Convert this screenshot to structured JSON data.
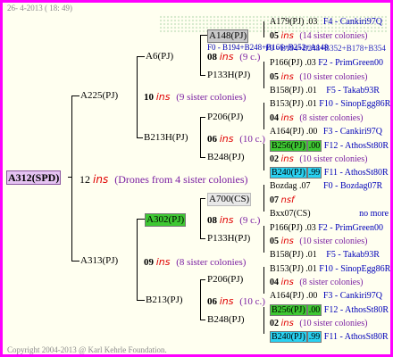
{
  "header": {
    "date": "26- 4-2013 ( 18: 49)"
  },
  "footer": {
    "copyright": "Copyright 2004-2013 @ Karl Kehrle Foundation."
  },
  "root": {
    "id": "A312(SPD)",
    "num": "12",
    "ins": "ins",
    "note": "(Drones from 4 sister colonies)"
  },
  "g1": {
    "top": {
      "id": "A225(PJ)",
      "num": "10",
      "ins": "ins",
      "note": "(9 sister colonies)"
    },
    "bottom": {
      "id": "A313(PJ)",
      "num": "09",
      "ins": "ins",
      "note": "(8 sister colonies)"
    }
  },
  "g2": {
    "a6": {
      "id": "A6(PJ)",
      "num": "08",
      "ins": "ins",
      "note": "(9 c.)"
    },
    "b213_top": {
      "id": "B213H(PJ)",
      "num": "06",
      "ins": "ins",
      "note": "(10 c.)"
    },
    "a302": {
      "id": "A302(PJ)",
      "num": "08",
      "ins": "ins",
      "note": "(9 c.)"
    },
    "b213_bottom": {
      "id": "B213(PJ)",
      "num": "06",
      "ins": "ins",
      "note": "(10 c.)"
    }
  },
  "g3": {
    "a148": {
      "id": "A148(PJ)"
    },
    "p133h_top": {
      "id": "P133H(PJ)"
    },
    "p206_top": {
      "id": "P206(PJ)"
    },
    "b248_top": {
      "id": "B248(PJ)"
    },
    "a700": {
      "id": "A700(CS)",
      "num": "07",
      "ins": "ins"
    },
    "p133h_bottom": {
      "id": "P133H(PJ)"
    },
    "p206_bottom": {
      "id": "P206(PJ)"
    },
    "b248_bottom": {
      "id": "B248(PJ)"
    }
  },
  "g4": {
    "r1": {
      "id": "A179(PJ)",
      "dot": ".03",
      "note": "F4 - Cankiri97Q"
    },
    "r2": {
      "num": "05",
      "ins": "ins",
      "note": "(14 sister colonies)"
    },
    "r3": {
      "text": "F0 - B194+B248+B166+B252+A148",
      "overlap": "F0 - B194+B248+B352+B178+B354"
    },
    "r4": {
      "id": "P166(PJ)",
      "dot": ".03",
      "note": "F2 - PrimGreen00"
    },
    "r5": {
      "num": "05",
      "ins": "ins",
      "note": "(10 sister colonies)"
    },
    "r6": {
      "id": "B158(PJ)",
      "dot": ".01",
      "note": "F5 - Takab93R"
    },
    "r7": {
      "id": "B153(PJ)",
      "dot": ".01",
      "note": "F10 - SinopEgg86R"
    },
    "r8": {
      "num": "04",
      "ins": "ins",
      "note": "(8 sister colonies)"
    },
    "r9": {
      "id": "A164(PJ)",
      "dot": ".00",
      "note": "F3 - Cankiri97Q"
    },
    "r10": {
      "id": "B256(PJ)",
      "dot": ".00",
      "note": "F12 - AthosSt80R"
    },
    "r11": {
      "num": "02",
      "ins": "ins",
      "note": "(10 sister colonies)"
    },
    "r12": {
      "id": "B240(PJ)",
      "dot": ".99",
      "note": "F11 - AthosSt80R"
    },
    "r13": {
      "id": "Bozdag",
      "dot": ".07",
      "note": "F0 - Bozdag07R"
    },
    "r14": {
      "num": "07",
      "ins": "nsf"
    },
    "r15": {
      "id": "Bxx07(CS)",
      "note": "no more"
    },
    "r16": {
      "id": "P166(PJ)",
      "dot": ".03",
      "note": "F2 - PrimGreen00"
    },
    "r17": {
      "num": "05",
      "ins": "ins",
      "note": "(10 sister colonies)"
    },
    "r18": {
      "id": "B158(PJ)",
      "dot": ".01",
      "note": "F5 - Takab93R"
    },
    "r19": {
      "id": "B153(PJ)",
      "dot": ".01",
      "note": "F10 - SinopEgg86R"
    },
    "r20": {
      "num": "04",
      "ins": "ins",
      "note": "(8 sister colonies)"
    },
    "r21": {
      "id": "A164(PJ)",
      "dot": ".00",
      "note": "F3 - Cankiri97Q"
    },
    "r22": {
      "id": "B256(PJ)",
      "dot": ".00",
      "note": "F12 - AthosSt80R"
    },
    "r23": {
      "num": "02",
      "ins": "ins",
      "note": "(10 sister colonies)"
    },
    "r24": {
      "id": "B240(PJ)",
      "dot": ".99",
      "note": "F11 - AthosSt80R"
    }
  },
  "colors": {
    "frame": "#ff00ff",
    "ins": "#e00000",
    "fline": "#0000b8",
    "root_highlight": "#e5c3f2",
    "green_highlight": "#3ec832",
    "cyan_highlight": "#29d2f2",
    "grey_highlight": "#c8c8c8"
  }
}
